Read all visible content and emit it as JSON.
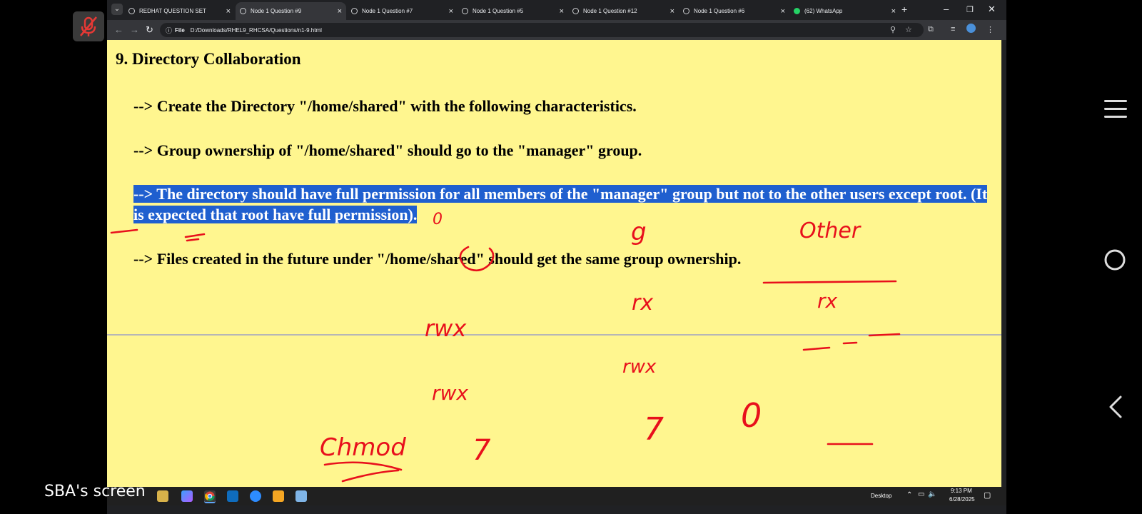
{
  "tabs": [
    {
      "label": "REDHAT QUESTION SET",
      "active": false
    },
    {
      "label": "Node 1 Question #9",
      "active": true
    },
    {
      "label": "Node 1 Question #7",
      "active": false
    },
    {
      "label": "Node 1 Question #5",
      "active": false
    },
    {
      "label": "Node 1 Question #12",
      "active": false
    },
    {
      "label": "Node 1 Question #6",
      "active": false
    },
    {
      "label": "(62) WhatsApp",
      "active": false
    }
  ],
  "address": {
    "prefix": "File",
    "url": "D:/Downloads/RHEL9_RHCSA/Questions/n1-9.html"
  },
  "page": {
    "title": "9. Directory Collaboration",
    "q1": "--> Create the Directory \"/home/shared\" with the following characteristics.",
    "q2": "--> Group ownership of \"/home/shared\" should go to the \"manager\" group.",
    "q3": "--> The directory should have full permission for all members of the \"manager\" group but not to the other users except root. (It is expected that root have full permission).",
    "q4": "--> Files created in the future under \"/home/shared\" should get the same group ownership."
  },
  "annotations": {
    "color": "#e8101c",
    "chmod": "Chmod",
    "rwx": "rwx",
    "seven": "7",
    "zero": "0",
    "g": "g",
    "other": "Other",
    "rx": "rx"
  },
  "taskbar": {
    "desktop": "Desktop",
    "time": "9:13 PM",
    "date": "6/28/2025"
  },
  "screen_label": "SBA's screen",
  "colors": {
    "page_bg": "#fff68f",
    "highlight": "#1f5fcf",
    "chrome_dark": "#202124",
    "chrome_toolbar": "#35363a"
  }
}
